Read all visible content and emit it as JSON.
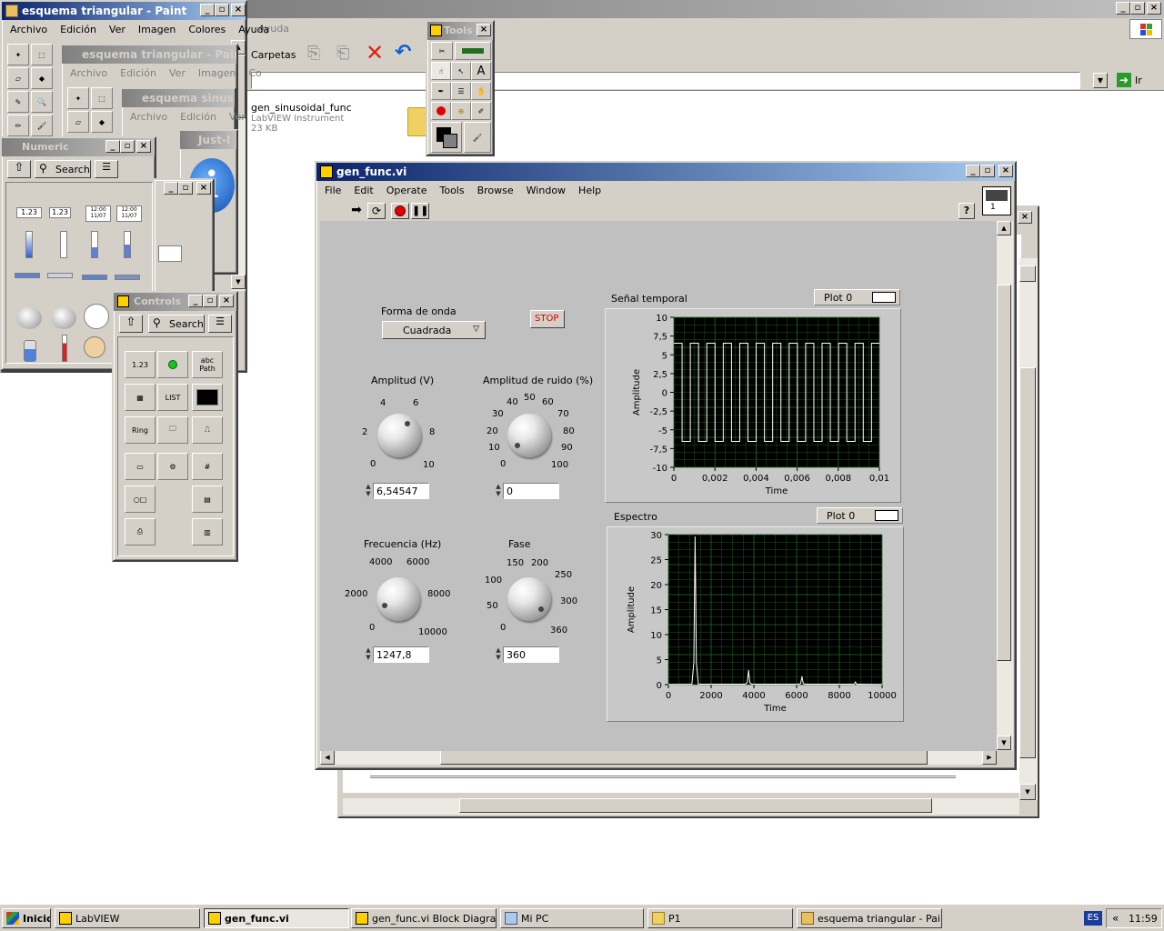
{
  "explorer": {
    "menu_help": "Ayuda",
    "toolbar_folders": "Carpetas",
    "go_label": "Ir",
    "file_name": "gen_sinusoidal_func",
    "file_type": "LabVIEW Instrument",
    "file_size": "23 KB"
  },
  "paint1": {
    "title": "esquema triangular - Paint",
    "menu": [
      "Archivo",
      "Edición",
      "Ver",
      "Imagen",
      "Colores",
      "Ayuda"
    ]
  },
  "paint2": {
    "title": "esquema triangular - Paint",
    "menu": [
      "Archivo",
      "Edición",
      "Ver",
      "Imagen",
      "Co"
    ]
  },
  "paint3": {
    "title": "esquema sinus - P",
    "menu": [
      "Archivo",
      "Edición",
      "Ver"
    ]
  },
  "justin": {
    "title": "Just-I"
  },
  "numeric_palette": {
    "title": "Numeric",
    "search": "Search",
    "items": [
      "1.23",
      "1.23",
      "12:00 11/07",
      "12:00 11/07"
    ]
  },
  "controls_palette": {
    "title": "Controls",
    "search": "Search",
    "items": [
      "1.23",
      "abc Path",
      "LIST",
      "Ring",
      "Enum",
      "#"
    ]
  },
  "tools_palette": {
    "title": "Tools"
  },
  "vi": {
    "title": "gen_func.vi",
    "menu": [
      "File",
      "Edit",
      "Operate",
      "Tools",
      "Browse",
      "Window",
      "Help"
    ],
    "help_icon": "?",
    "vi_icon_label": "1"
  },
  "panel": {
    "waveform_label": "Forma de onda",
    "waveform_value": "Cuadrada",
    "stop_label": "STOP",
    "amp_label": "Amplitud (V)",
    "amp_ticks": [
      "0",
      "2",
      "4",
      "6",
      "8",
      "10"
    ],
    "amp_value": "6,54547",
    "noise_label": "Amplitud de ruido (%)",
    "noise_ticks": [
      "0",
      "10",
      "20",
      "30",
      "40",
      "50",
      "60",
      "70",
      "80",
      "90",
      "100"
    ],
    "noise_value": "0",
    "freq_label": "Frecuencia (Hz)",
    "freq_ticks": [
      "0",
      "2000",
      "4000",
      "6000",
      "8000",
      "10000"
    ],
    "freq_value": "1247,8",
    "phase_label": "Fase",
    "phase_ticks": [
      "0",
      "50",
      "100",
      "150",
      "200",
      "250",
      "300",
      "360"
    ],
    "phase_value": "360"
  },
  "chart_data": [
    {
      "type": "line",
      "title": "Señal temporal",
      "legend": "Plot 0",
      "xlabel": "Time",
      "ylabel": "Amplitude",
      "xlim": [
        0,
        0.01
      ],
      "ylim": [
        -10,
        10
      ],
      "x_ticks": [
        "0",
        "0,002",
        "0,004",
        "0,006",
        "0,008",
        "0,01"
      ],
      "y_ticks": [
        "10",
        "7,5",
        "5",
        "2,5",
        "0",
        "-2,5",
        "-5",
        "-7,5",
        "-10"
      ],
      "series": [
        {
          "name": "Plot 0",
          "waveform": "square",
          "amplitude": 6.54547,
          "frequency_hz": 1247.8,
          "phase_deg": 360
        }
      ],
      "grid": true,
      "background": "#000000",
      "grid_color": "#1f6f1f",
      "line_color": "#ffffff"
    },
    {
      "type": "line",
      "title": "Espectro",
      "legend": "Plot 0",
      "xlabel": "Time",
      "ylabel": "Amplitude",
      "xlim": [
        0,
        10000
      ],
      "ylim": [
        0,
        30
      ],
      "x_ticks": [
        "0",
        "2000",
        "4000",
        "6000",
        "8000",
        "10000"
      ],
      "y_ticks": [
        "30",
        "25",
        "20",
        "15",
        "10",
        "5",
        "0"
      ],
      "series": [
        {
          "name": "Plot 0",
          "peaks": [
            [
              1250,
              29.5
            ],
            [
              3750,
              2.8
            ],
            [
              6250,
              1.6
            ],
            [
              8750,
              0.5
            ]
          ]
        }
      ],
      "grid": true,
      "background": "#000000",
      "grid_color": "#1f6f1f",
      "line_color": "#ffffff"
    }
  ],
  "taskbar": {
    "start": "Inicio",
    "tasks": [
      "LabVIEW",
      "gen_func.vi",
      "gen_func.vi Block Diagra...",
      "Mi PC",
      "P1",
      "esquema triangular - Paint"
    ],
    "lang": "ES",
    "time": "11:59",
    "chevron": "«"
  }
}
